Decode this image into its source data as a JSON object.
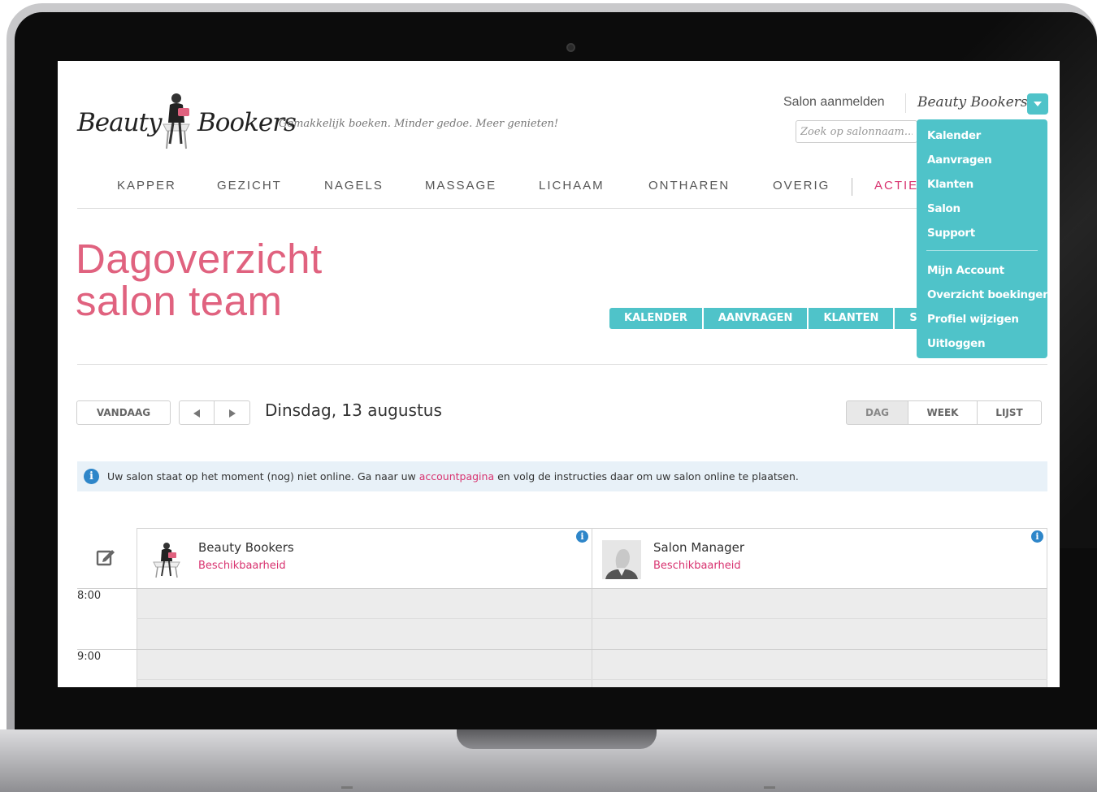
{
  "header": {
    "logo_left": "Beauty",
    "logo_right": "Bookers",
    "tagline": "Gemakkelijk boeken. Minder gedoe. Meer genieten!",
    "salon_aanmelden": "Salon aanmelden",
    "user_name": "Beauty Bookers",
    "search_placeholder": "Zoek op salonnaam..."
  },
  "nav": {
    "items": [
      "KAPPER",
      "GEZICHT",
      "NAGELS",
      "MASSAGE",
      "LICHAAM",
      "ONTHAREN",
      "OVERIG"
    ],
    "accent_item": "ACTIES"
  },
  "page": {
    "title_line1": "Dagoverzicht",
    "title_line2": "salon team"
  },
  "subtabs": [
    "KALENDER",
    "AANVRAGEN",
    "KLANTEN",
    "SALON"
  ],
  "toolbar": {
    "today": "VANDAAG",
    "date": "Dinsdag, 13 augustus",
    "views": [
      "DAG",
      "WEEK",
      "LIJST"
    ],
    "active_view": "DAG"
  },
  "info": {
    "text_before": "Uw salon staat op het moment (nog) niet online. Ga naar uw ",
    "link": "accountpagina",
    "text_after": " en volg de instructies daar om uw salon online te plaatsen."
  },
  "calendar": {
    "staff": [
      {
        "name": "Beauty Bookers",
        "link": "Beschikbaarheid"
      },
      {
        "name": "Salon Manager",
        "link": "Beschikbaarheid"
      }
    ],
    "times": [
      "8:00",
      "9:00"
    ]
  },
  "dropdown": {
    "group1": [
      "Kalender",
      "Aanvragen",
      "Klanten",
      "Salon",
      "Support"
    ],
    "group2": [
      "Mijn Account",
      "Overzicht boekingen",
      "Profiel wijzigen",
      "Uitloggen"
    ]
  },
  "colors": {
    "accent_teal": "#4fc3c9",
    "accent_pink": "#e0627f",
    "link_pink": "#d8326f",
    "info_blue": "#2e86c9",
    "info_bg": "#e8f1f8"
  }
}
